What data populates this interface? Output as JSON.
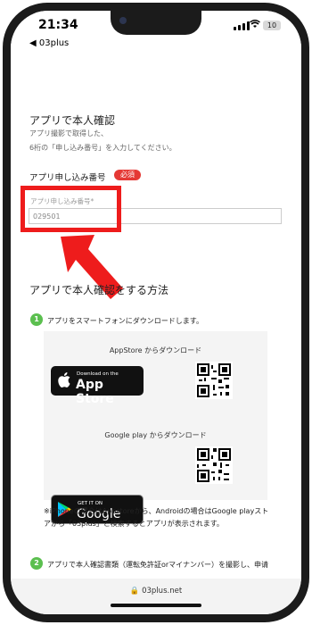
{
  "status": {
    "time": "21:34",
    "back_app": "◀ 03plus",
    "battery": "10"
  },
  "page": {
    "section_title": "アプリで本人確認",
    "desc_line1": "アプリ撮影で取得した、",
    "desc_line2": "6桁の「申し込み番号」を入力してください。",
    "field_label": "アプリ申し込み番号",
    "required_badge": "必須",
    "input_floating_label": "アプリ申し込み番号*",
    "input_value": "029501",
    "method_title": "アプリで本人確認をする方法",
    "step1_number": "1",
    "step1_text": "アプリをスマートフォンにダウンロードします。",
    "appstore_caption": "AppStore からダウンロード",
    "appstore_badge_small": "Download on the",
    "appstore_badge_big": "App Store",
    "googleplay_caption": "Google play からダウンロード",
    "googleplay_badge_small": "GET IT ON",
    "googleplay_badge_big": "Google Play",
    "note": "※iPhoneの場合はAppstoreから、Androidの場合はGoogle playストアから「03plus」と検索するとアプリが表示されます。",
    "step2_number": "2",
    "step2_text": "アプリで本人確認書類（運転免許証orマイナンバー）を撮影し、申请",
    "url": "🔒 03plus.net"
  },
  "colors": {
    "highlight": "#ee1c1c",
    "required": "#e53935",
    "step": "#5bbf4f"
  },
  "icons": [
    "apple-icon",
    "google-play-icon",
    "lock-icon",
    "wifi-icon",
    "signal-icon",
    "battery-icon",
    "arrow-icon"
  ]
}
